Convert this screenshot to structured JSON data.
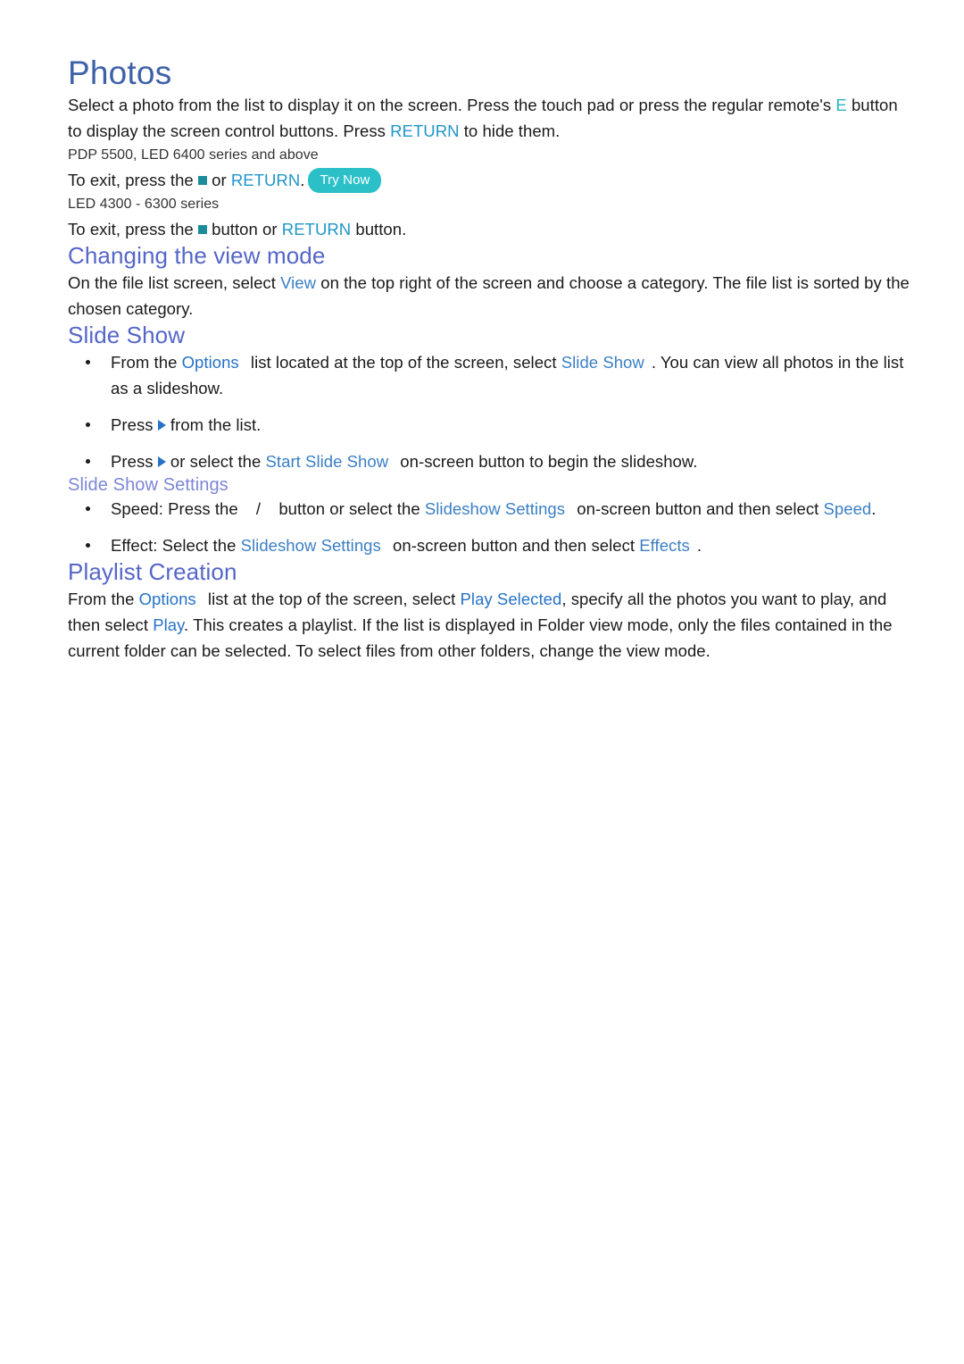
{
  "document": {
    "title": "Photos",
    "colors": {
      "title": "#3E62A8",
      "section_heading": "#5566C8",
      "subsection_heading": "#7C87D6",
      "link_blue": "#2672C8",
      "link_cyan": "#2196C8",
      "glyph_teal": "#2BB3BD",
      "badge_teal": "#2BC0C8",
      "body_text": "#1A1A1A",
      "background": "#FFFFFF"
    }
  },
  "intro": {
    "part1": "Select a photo from the list to display it on the screen. Press the touch pad or press the regular remote's ",
    "glyph_e": "E",
    "part2": " button to display the screen control buttons. Press ",
    "return_link": "RETURN",
    "part3": " to hide them."
  },
  "note_a": {
    "models": "PDP 5500, LED 6400 series and above",
    "exit_prefix": "To exit, press the ",
    "exit_mid": " or ",
    "return_link": "RETURN",
    "exit_suffix": ".",
    "try_now": "Try Now"
  },
  "note_b": {
    "models": "LED 4300 - 6300 series",
    "exit_prefix": "To exit, press the ",
    "exit_mid": " button or ",
    "return_link": "RETURN",
    "exit_suffix": " button."
  },
  "view_mode": {
    "heading": "Changing the view mode",
    "body_part1": "On the file list screen, select ",
    "view_link": "View",
    "body_part2": " on the top right of the screen and choose a category. The file list is sorted by the chosen category."
  },
  "slide_show": {
    "heading": "Slide Show",
    "bullets": [
      {
        "part1": "From the ",
        "link1": "Options",
        "part2": " list located at the top of the screen, select ",
        "link2": "Slide Show",
        "part3": ". You can view all photos in the list as a slideshow."
      },
      {
        "part1": "Press ",
        "part2": " from the list."
      },
      {
        "part1": "Press ",
        "part2": " or select the ",
        "link1": "Start Slide Show",
        "part3": " on-screen button to begin the slideshow."
      }
    ]
  },
  "slide_show_settings": {
    "heading": "Slide Show Settings",
    "bullets": [
      {
        "part1": "Speed: Press the ",
        "separator": "/",
        "part2": " button or select the ",
        "link1": "Slideshow Settings",
        "part3": " on-screen button and then select ",
        "link2": "Speed",
        "part4": "."
      },
      {
        "part1": "Effect: Select the ",
        "link1": "Slideshow Settings",
        "part2": " on-screen button and then select ",
        "link2": "Effects",
        "part3": "."
      }
    ]
  },
  "playlist": {
    "heading": "Playlist Creation",
    "part1": "From the ",
    "link1": "Options",
    "part2": " list at the top of the screen, select ",
    "link2": "Play Selected",
    "part3": ", specify all the photos you want to play, and then select ",
    "link3": "Play",
    "part4": ". This creates a playlist. If the list is displayed in Folder view mode, only the files contained in the current folder can be selected. To select files from other folders, change the view mode."
  }
}
